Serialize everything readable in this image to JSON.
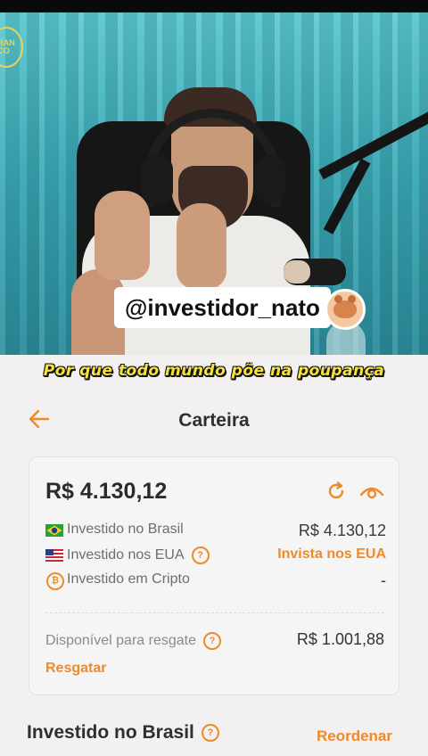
{
  "video": {
    "handle": "@investidor_nato",
    "channel_logo_text": "RAN\nCO",
    "subtitle": "Por que todo mundo põe na poupança"
  },
  "header": {
    "title": "Carteira",
    "back_icon": "arrow-left-icon"
  },
  "summary": {
    "total": "R$ 4.130,12",
    "refresh_icon": "refresh-icon",
    "visibility_icon": "eye-icon",
    "rows": [
      {
        "flag": "brazil-flag-icon",
        "label": "Investido no Brasil",
        "value": "R$ 4.130,12"
      },
      {
        "flag": "usa-flag-icon",
        "label": "Investido nos EUA",
        "value": "Invista nos EUA",
        "help": "?"
      },
      {
        "flag": "bitcoin-icon",
        "label": "Investido em Cripto",
        "value": "-",
        "coin_symbol": "₿"
      }
    ],
    "available_label": "Disponível para resgate",
    "available_help": "?",
    "available_value": "R$ 1.001,88",
    "withdraw_label": "Resgatar"
  },
  "section": {
    "title": "Investido no Brasil",
    "help": "?",
    "reorder_label": "Reordenar"
  },
  "colors": {
    "accent": "#ef8a2a",
    "background": "#f2f0f0",
    "subtitle": "#f6e23a"
  }
}
